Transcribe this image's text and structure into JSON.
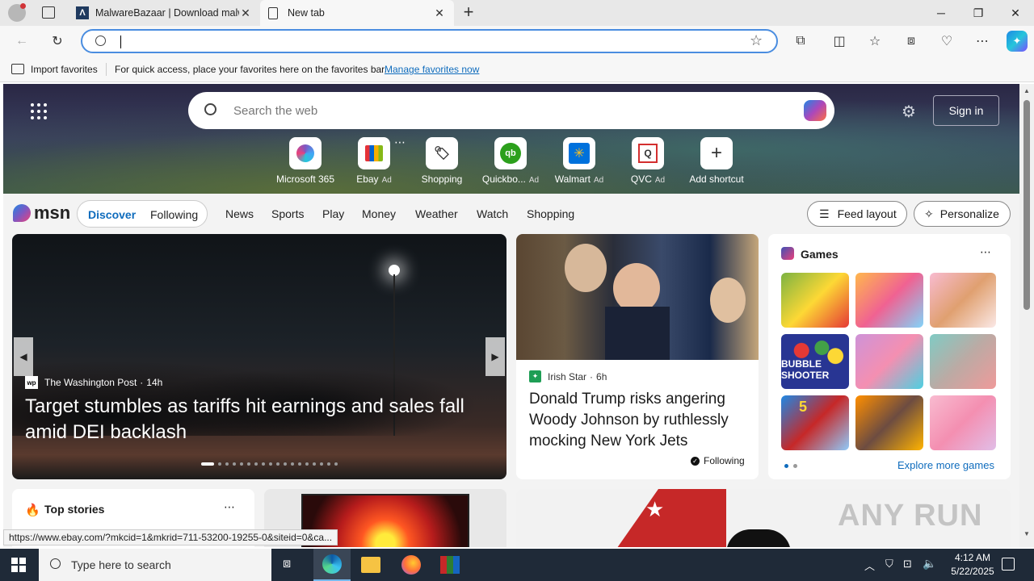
{
  "tabs": [
    {
      "title": "MalwareBazaar | Download malw",
      "icon": "malwarebazaar-icon"
    },
    {
      "title": "New tab",
      "icon": "page-icon"
    }
  ],
  "favorites_bar": {
    "import_label": "Import favorites",
    "message": "For quick access, place your favorites here on the favorites bar.",
    "manage_link": "Manage favorites now"
  },
  "hero": {
    "search_placeholder": "Search the web",
    "sign_in": "Sign in",
    "shortcuts": [
      {
        "label": "Microsoft 365",
        "ad": ""
      },
      {
        "label": "Ebay",
        "ad": "Ad"
      },
      {
        "label": "Shopping",
        "ad": ""
      },
      {
        "label": "Quickbo...",
        "ad": "Ad"
      },
      {
        "label": "Walmart",
        "ad": "Ad"
      },
      {
        "label": "QVC",
        "ad": "Ad"
      },
      {
        "label": "Add shortcut",
        "ad": ""
      }
    ]
  },
  "msn": {
    "logo": "msn",
    "pills": [
      "Discover",
      "Following"
    ],
    "nav": [
      "News",
      "Sports",
      "Play",
      "Money",
      "Weather",
      "Watch",
      "Shopping"
    ],
    "feed_layout": "Feed layout",
    "personalize": "Personalize"
  },
  "main_story": {
    "source": "The Washington Post",
    "time": "14h",
    "headline": "Target stumbles as tariffs hit earnings and sales fall amid DEI backlash"
  },
  "second_story": {
    "source": "Irish Star",
    "time": "6h",
    "headline": "Donald Trump risks angering Woody Johnson by ruthlessly mocking New York Jets",
    "following": "Following"
  },
  "games": {
    "title": "Games",
    "explore": "Explore more games",
    "tiles": [
      {
        "label": ""
      },
      {
        "label": ""
      },
      {
        "label": ""
      },
      {
        "label": "BUBBLE SHOOTER"
      },
      {
        "label": ""
      },
      {
        "label": ""
      },
      {
        "label": "5"
      },
      {
        "label": ""
      },
      {
        "label": ""
      }
    ]
  },
  "top_stories": {
    "title": "Top stories"
  },
  "status_url": "https://www.ebay.com/?mkcid=1&mkrid=711-53200-19255-0&siteid=0&ca...",
  "watermark": "ANY RUN",
  "taskbar": {
    "search_placeholder": "Type here to search",
    "time": "4:12 AM",
    "date": "5/22/2025"
  },
  "colors": {
    "accent": "#0f6cbd",
    "taskbar": "#1f2a38",
    "address_border": "#4a8de0"
  }
}
